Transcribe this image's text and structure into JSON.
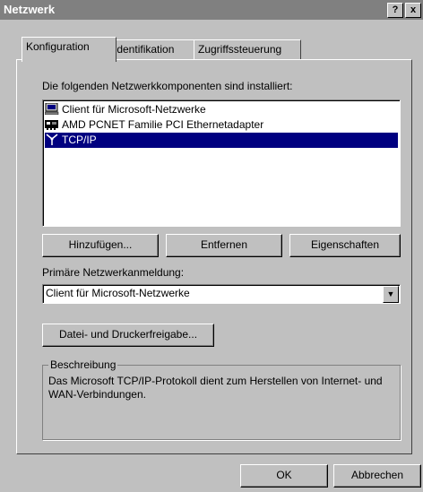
{
  "window": {
    "title": "Netzwerk",
    "help_btn": "?",
    "close_btn": "x"
  },
  "tabs": [
    {
      "label": "Konfiguration",
      "active": true
    },
    {
      "label": "Identifikation",
      "active": false
    },
    {
      "label": "Zugriffssteuerung",
      "active": false
    }
  ],
  "config": {
    "components_label": "Die folgenden Netzwerkkomponenten sind installiert:",
    "components": [
      {
        "label": "Client für Microsoft-Netzwerke",
        "icon": "network-client-icon",
        "selected": false
      },
      {
        "label": "AMD PCNET Familie PCI Ethernetadapter",
        "icon": "network-adapter-icon",
        "selected": false
      },
      {
        "label": "TCP/IP",
        "icon": "protocol-icon",
        "selected": true
      }
    ],
    "add_button": "Hinzufügen...",
    "remove_button": "Entfernen",
    "properties_button": "Eigenschaften",
    "primary_logon_label": "Primäre Netzwerkanmeldung:",
    "primary_logon_value": "Client für Microsoft-Netzwerke",
    "file_print_button": "Datei- und Druckerfreigabe...",
    "description_title": "Beschreibung",
    "description_text": "Das Microsoft TCP/IP-Protokoll dient zum Herstellen von Internet- und WAN-Verbindungen."
  },
  "footer": {
    "ok_button": "OK",
    "cancel_button": "Abbrechen"
  }
}
